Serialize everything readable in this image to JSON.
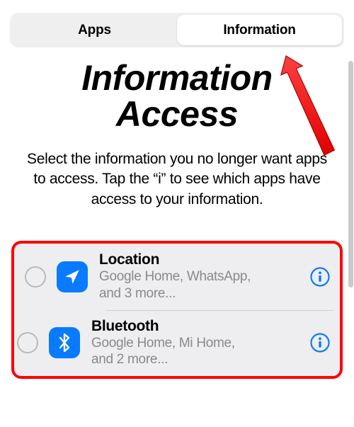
{
  "tabs": {
    "apps_label": "Apps",
    "info_label": "Information"
  },
  "title_line1": "Information",
  "title_line2": "Access",
  "subtitle": "Select the information you no longer want apps to access. Tap the “i” to see which apps have access to your information.",
  "items": [
    {
      "title": "Location",
      "sub_line1": "Google Home, WhatsApp,",
      "sub_line2": "and 3 more...",
      "icon": "location-arrow-icon"
    },
    {
      "title": "Bluetooth",
      "sub_line1": "Google Home, Mi Home,",
      "sub_line2": "and 2 more...",
      "icon": "bluetooth-icon"
    }
  ],
  "colors": {
    "accent_blue": "#0a7aff",
    "annotation_red": "#ff0000"
  }
}
